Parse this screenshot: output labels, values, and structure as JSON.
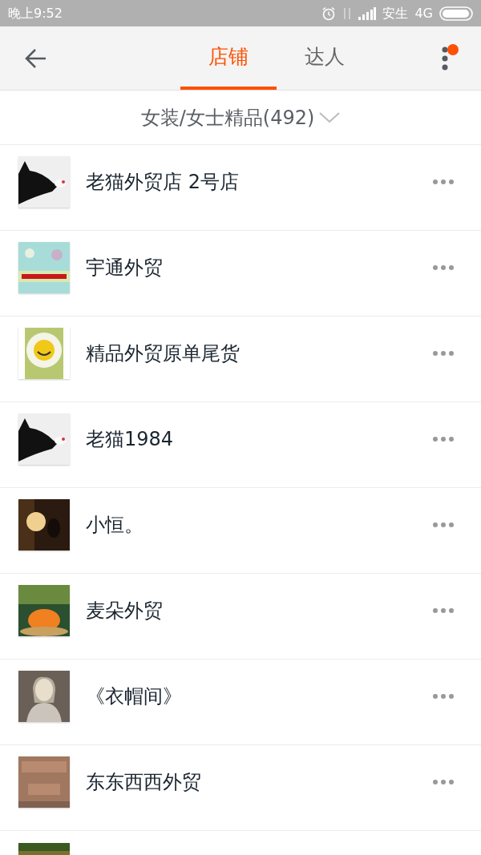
{
  "status_bar": {
    "time": "晚上9:52",
    "carrier": "安生",
    "network": "4G"
  },
  "header": {
    "tabs": [
      {
        "label": "店铺",
        "selected": true
      },
      {
        "label": "达人",
        "selected": false
      }
    ],
    "menu_badge": true
  },
  "filter": {
    "label": "女装/女士精品(492)"
  },
  "shops": [
    {
      "name": "老猫外贸店 2号店"
    },
    {
      "name": "宇通外贸"
    },
    {
      "name": "精品外贸原单尾货"
    },
    {
      "name": "老猫1984"
    },
    {
      "name": "小恒。"
    },
    {
      "name": "麦朵外贸"
    },
    {
      "name": "《衣帽间》"
    },
    {
      "name": "东东西西外贸"
    }
  ],
  "more_rows_below": true
}
